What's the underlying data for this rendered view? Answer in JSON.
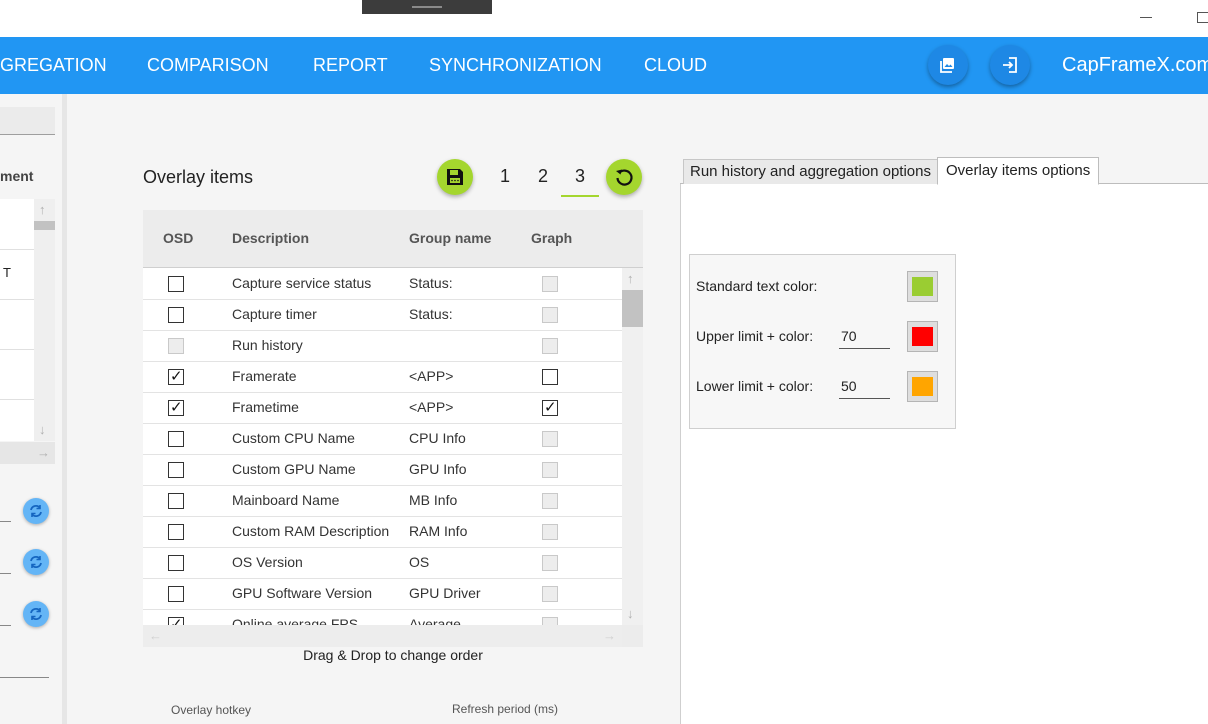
{
  "nav": {
    "items": [
      "GREGATION",
      "COMPARISON",
      "REPORT",
      "SYNCHRONIZATION",
      "CLOUD"
    ],
    "brand": "CapFrameX.com",
    "buttons": [
      "screenshot-icon",
      "login-icon"
    ]
  },
  "sidebar": {
    "column_header": "ment",
    "row_text": "T"
  },
  "overlay": {
    "title": "Overlay items",
    "config_tabs": [
      "1",
      "2",
      "3"
    ],
    "selected_config": "3",
    "columns": {
      "osd": "OSD",
      "description": "Description",
      "group": "Group name",
      "graph": "Graph"
    },
    "rows": [
      {
        "osd": "unchecked",
        "description": "Capture service status",
        "group": "Status:",
        "graph": "disabled"
      },
      {
        "osd": "unchecked",
        "description": "Capture timer",
        "group": "Status:",
        "graph": "disabled"
      },
      {
        "osd": "disabled",
        "description": "Run history",
        "group": "",
        "graph": "disabled"
      },
      {
        "osd": "checked",
        "description": "Framerate",
        "group": "<APP>",
        "graph": "unchecked"
      },
      {
        "osd": "checked",
        "description": "Frametime",
        "group": "<APP>",
        "graph": "checked"
      },
      {
        "osd": "unchecked",
        "description": "Custom CPU Name",
        "group": "CPU Info",
        "graph": "disabled"
      },
      {
        "osd": "unchecked",
        "description": "Custom GPU Name",
        "group": "GPU Info",
        "graph": "disabled"
      },
      {
        "osd": "unchecked",
        "description": "Mainboard Name",
        "group": "MB Info",
        "graph": "disabled"
      },
      {
        "osd": "unchecked",
        "description": "Custom RAM Description",
        "group": "RAM Info",
        "graph": "disabled"
      },
      {
        "osd": "unchecked",
        "description": "OS Version",
        "group": "OS",
        "graph": "disabled"
      },
      {
        "osd": "unchecked",
        "description": "GPU Software Version",
        "group": "GPU Driver",
        "graph": "disabled"
      },
      {
        "osd": "checked",
        "description": "Online average FPS",
        "group": "Average",
        "graph": "disabled"
      }
    ],
    "drag_hint": "Drag & Drop to change order",
    "hotkey_label": "Overlay hotkey",
    "refresh_label": "Refresh period (ms)"
  },
  "right_panel": {
    "tabs": [
      "Run history and aggregation options",
      "Overlay items options"
    ],
    "active_tab": "Overlay items options",
    "standard_label": "Standard text color:",
    "standard_color": "#9acd32",
    "upper_label": "Upper limit + color:",
    "upper_value": "70",
    "upper_color": "#ff0000",
    "lower_label": "Lower limit + color:",
    "lower_value": "50",
    "lower_color": "#ffa500"
  },
  "colors": {
    "nav_bg": "#2196f3",
    "accent_green": "#a4d62e"
  }
}
